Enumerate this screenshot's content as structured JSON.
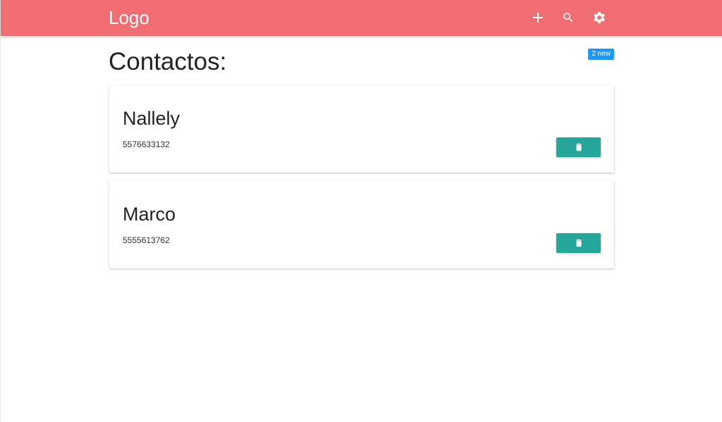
{
  "navbar": {
    "logo": "Logo",
    "background_color": "#f06e73",
    "icons": [
      "add-icon",
      "search-icon",
      "settings-icon"
    ]
  },
  "main": {
    "title": "Contactos:",
    "badge": "2 new",
    "badge_color": "#2196f3"
  },
  "contacts": [
    {
      "name": "Nallely",
      "phone": "5576633132",
      "action_icon": "delete-icon"
    },
    {
      "name": "Marco",
      "phone": "5555613762",
      "action_icon": "delete-icon"
    }
  ],
  "colors": {
    "delete_button": "#26a69a"
  }
}
